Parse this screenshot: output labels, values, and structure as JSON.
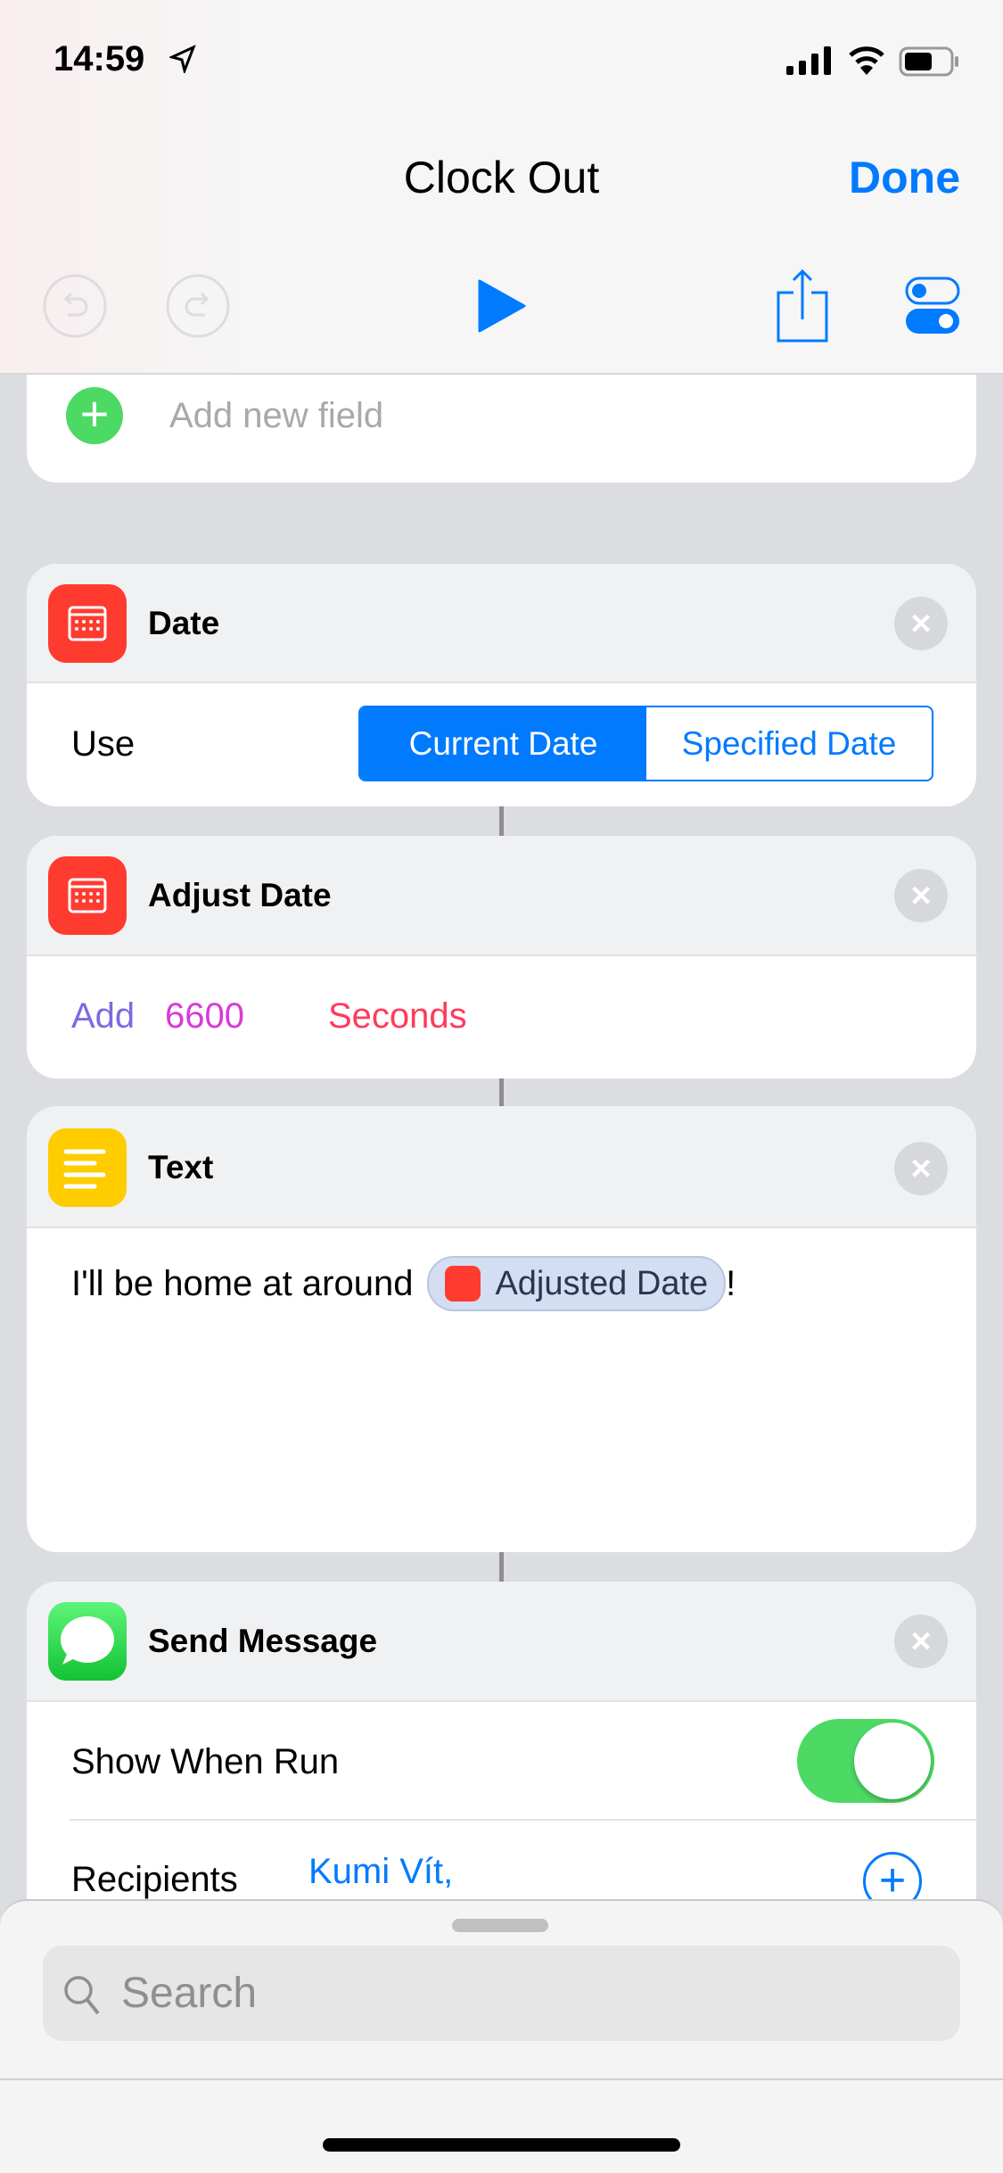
{
  "status_bar": {
    "time": "14:59"
  },
  "nav": {
    "title": "Clock Out",
    "done_label": "Done"
  },
  "toolbar": {
    "icons": [
      "undo-icon",
      "redo-icon",
      "play-icon",
      "share-icon",
      "settings-toggle-icon"
    ]
  },
  "add_field": {
    "label": "Add new field"
  },
  "actions": [
    {
      "title": "Date",
      "use_label": "Use",
      "segments": [
        "Current Date",
        "Specified Date"
      ],
      "selected": "Current Date",
      "color": "#ff3b30"
    },
    {
      "title": "Adjust Date",
      "operation": "Add",
      "amount": "6600",
      "unit": "Seconds",
      "color": "#ff3b30"
    },
    {
      "title": "Text",
      "text": "I'll be home at around",
      "variable": "Adjusted Date",
      "suffix": "!",
      "color": "#ffcc00"
    },
    {
      "title": "Send Message",
      "show_when_run_label": "Show When Run",
      "show_when_run": true,
      "recipients_label": "Recipients",
      "recipient": "Kumi Vít,",
      "color": "#34c759"
    }
  ],
  "bottom_sheet": {
    "search_placeholder": "Search"
  },
  "colors": {
    "accent": "#007aff",
    "green": "#4cd964"
  }
}
